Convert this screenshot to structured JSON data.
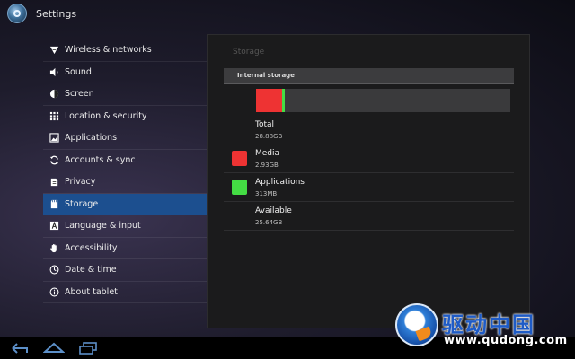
{
  "app": {
    "title": "Settings"
  },
  "sidebar": {
    "items": [
      {
        "label": "Wireless & networks",
        "icon": "wifi-icon"
      },
      {
        "label": "Sound",
        "icon": "speaker-icon"
      },
      {
        "label": "Screen",
        "icon": "brightness-icon"
      },
      {
        "label": "Location & security",
        "icon": "grid-lock-icon"
      },
      {
        "label": "Applications",
        "icon": "applications-icon"
      },
      {
        "label": "Accounts & sync",
        "icon": "sync-icon"
      },
      {
        "label": "Privacy",
        "icon": "privacy-icon"
      },
      {
        "label": "Storage",
        "icon": "storage-icon",
        "selected": true
      },
      {
        "label": "Language & input",
        "icon": "language-icon"
      },
      {
        "label": "Accessibility",
        "icon": "hand-icon"
      },
      {
        "label": "Date & time",
        "icon": "clock-icon"
      },
      {
        "label": "About tablet",
        "icon": "info-icon"
      }
    ]
  },
  "storage": {
    "panel_title": "Storage",
    "section_header": "Internal storage",
    "usage_bar": {
      "track_color": "#3a3a3c",
      "segments": [
        {
          "name": "Media",
          "fraction": 0.102,
          "color": "#ee3333"
        },
        {
          "name": "Applications",
          "fraction": 0.0109,
          "color": "#44dd44"
        }
      ]
    },
    "rows": [
      {
        "label": "Total",
        "value": "28.88GB"
      },
      {
        "label": "Media",
        "value": "2.93GB",
        "color": "#ee3333"
      },
      {
        "label": "Applications",
        "value": "313MB",
        "color": "#44dd44"
      },
      {
        "label": "Available",
        "value": "25.64GB"
      }
    ]
  },
  "navbar": {
    "buttons": [
      {
        "name": "back-button",
        "icon": "back-icon"
      },
      {
        "name": "home-button",
        "icon": "home-icon"
      },
      {
        "name": "recent-apps-button",
        "icon": "recent-apps-icon"
      }
    ]
  },
  "watermark": {
    "text_cn": "驱动中国",
    "url": "www.qudong.com"
  }
}
